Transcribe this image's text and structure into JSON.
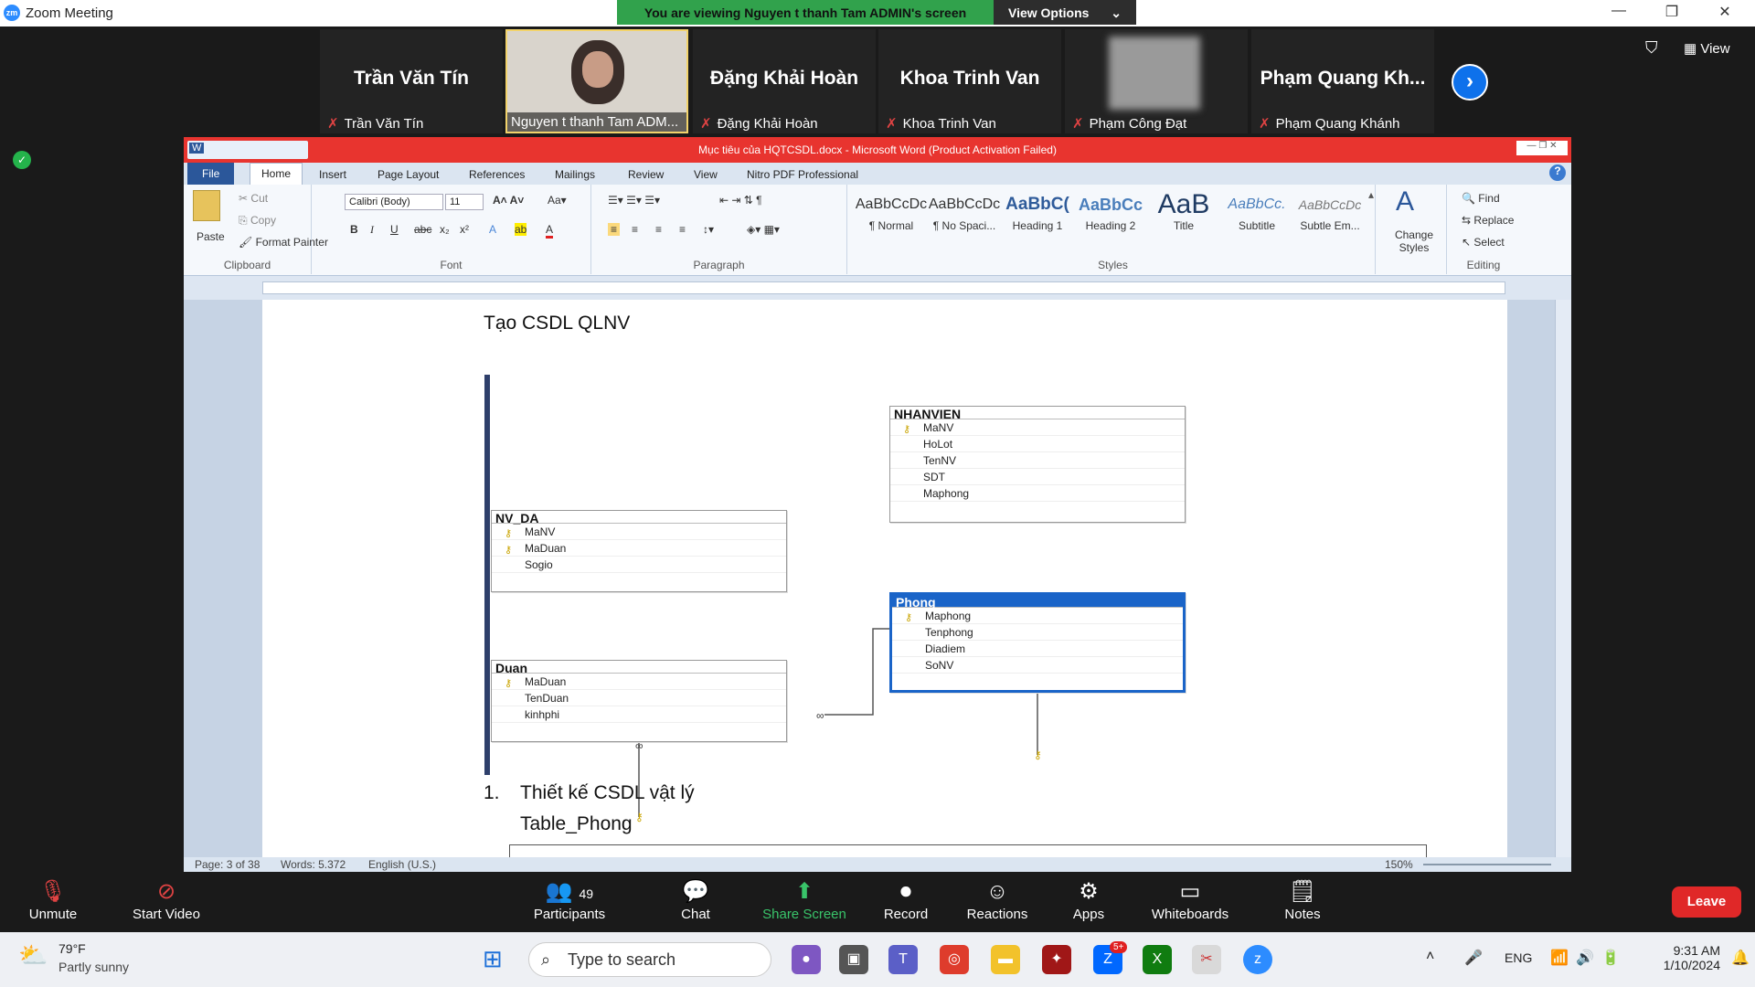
{
  "window": {
    "title": "Zoom Meeting"
  },
  "banner": {
    "viewing": "You are viewing Nguyen t thanh Tam ADMIN's screen",
    "view_options": "View Options"
  },
  "participants": [
    {
      "big": "Trần Văn Tín",
      "name": "Trần Văn Tín"
    },
    {
      "big": "",
      "name": "Nguyen t thanh Tam ADM..."
    },
    {
      "big": "Đặng Khải Hoàn",
      "name": "Đặng Khải Hoàn"
    },
    {
      "big": "Khoa Trinh Van",
      "name": "Khoa Trinh Van"
    },
    {
      "big": "",
      "name": "Phạm Công Đạt"
    },
    {
      "big": "Phạm  Quang  Kh...",
      "name": "Phạm Quang Khánh"
    }
  ],
  "view_label": "View",
  "word": {
    "title": "Mục tiêu của HQTCSDL.docx - Microsoft Word (Product Activation Failed)",
    "tabs": [
      "File",
      "Home",
      "Insert",
      "Page Layout",
      "References",
      "Mailings",
      "Review",
      "View",
      "Nitro PDF Professional"
    ],
    "clipboard": {
      "paste": "Paste",
      "cut": "Cut",
      "copy": "Copy",
      "format_painter": "Format Painter",
      "label": "Clipboard"
    },
    "font": {
      "name": "Calibri (Body)",
      "size": "11",
      "label": "Font"
    },
    "paragraph_label": "Paragraph",
    "styles": [
      {
        "preview": "AaBbCcDc",
        "name": "¶ Normal"
      },
      {
        "preview": "AaBbCcDc",
        "name": "¶ No Spaci..."
      },
      {
        "preview": "AaBbC(",
        "name": "Heading 1"
      },
      {
        "preview": "AaBbCc",
        "name": "Heading 2"
      },
      {
        "preview": "AaB",
        "name": "Title"
      },
      {
        "preview": "AaBbCc.",
        "name": "Subtitle"
      },
      {
        "preview": "AaBbCcDc",
        "name": "Subtle Em..."
      }
    ],
    "styles_label": "Styles",
    "change_styles": "Change Styles",
    "editing": {
      "find": "Find",
      "replace": "Replace",
      "select": "Select",
      "label": "Editing"
    },
    "doc": {
      "heading": "Tạo CSDL QLNV",
      "tables": [
        {
          "name": "NHANVIEN",
          "fields": [
            {
              "n": "MaNV",
              "k": true
            },
            {
              "n": "HoLot",
              "k": false
            },
            {
              "n": "TenNV",
              "k": false
            },
            {
              "n": "SDT",
              "k": false
            },
            {
              "n": "Maphong",
              "k": false
            }
          ]
        },
        {
          "name": "NV_DA",
          "fields": [
            {
              "n": "MaNV",
              "k": true
            },
            {
              "n": "MaDuan",
              "k": true
            },
            {
              "n": "Sogio",
              "k": false
            }
          ]
        },
        {
          "name": "Phong",
          "fields": [
            {
              "n": "Maphong",
              "k": true
            },
            {
              "n": "Tenphong",
              "k": false
            },
            {
              "n": "Diadiem",
              "k": false
            },
            {
              "n": "SoNV",
              "k": false
            }
          ]
        },
        {
          "name": "Duan",
          "fields": [
            {
              "n": "MaDuan",
              "k": true
            },
            {
              "n": "TenDuan",
              "k": false
            },
            {
              "n": "kinhphi",
              "k": false
            }
          ]
        }
      ],
      "list_num": "1.",
      "list_text": "Thiết kế CSDL vật lý",
      "sub": "Table_Phong"
    },
    "status": {
      "page": "Page: 3 of 38",
      "words": "Words: 5.372",
      "lang": "English (U.S.)",
      "zoom": "150%"
    }
  },
  "toolbar": {
    "unmute": "Unmute",
    "start_video": "Start Video",
    "participants": "Participants",
    "participants_count": "49",
    "chat": "Chat",
    "share": "Share Screen",
    "record": "Record",
    "reactions": "Reactions",
    "apps": "Apps",
    "whiteboards": "Whiteboards",
    "notes": "Notes",
    "leave": "Leave"
  },
  "taskbar": {
    "temp": "79°F",
    "weather": "Partly sunny",
    "search": "Type to search",
    "lang": "ENG",
    "time": "9:31 AM",
    "date": "1/10/2024",
    "badge": "5+"
  }
}
